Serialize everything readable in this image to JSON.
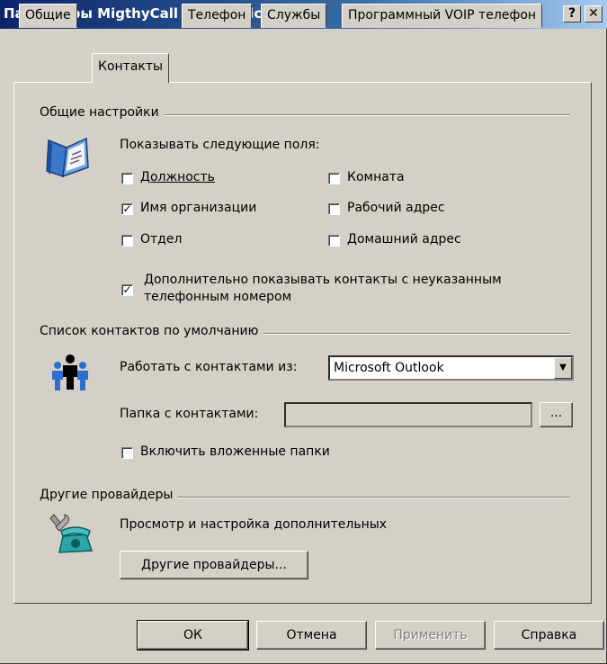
{
  "window": {
    "title": "Параметры MigthyCall Communicator",
    "help_btn": "?",
    "close_btn": "✕"
  },
  "tabs": [
    {
      "label": "Общие"
    },
    {
      "label": "Контакты"
    },
    {
      "label": "Телефон"
    },
    {
      "label": "Службы"
    },
    {
      "label": "Программный VOIP телефон"
    }
  ],
  "general": {
    "group_label": "Общие настройки",
    "show_fields_label": "Показывать следующие поля:",
    "fields": [
      {
        "label": "Должность",
        "checked": false
      },
      {
        "label": "Комната",
        "checked": false
      },
      {
        "label": "Имя организации",
        "checked": true
      },
      {
        "label": "Рабочий адрес",
        "checked": false
      },
      {
        "label": "Отдел",
        "checked": false
      },
      {
        "label": "Домашний адрес",
        "checked": false
      }
    ],
    "extra": {
      "line1": "Дополнительно показывать контакты с неуказанным",
      "line2": "телефонным номером",
      "checked": true
    }
  },
  "default_list": {
    "group_label": "Список контактов по умолчанию",
    "work_with_label": "Работать с контактами из:",
    "work_with_value": "Microsoft Outlook",
    "folder_label": "Папка с контактами:",
    "folder_value": "",
    "browse_label": "...",
    "subfolders_label": "Включить вложенные папки",
    "subfolders_checked": false
  },
  "providers": {
    "group_label": "Другие провайдеры",
    "description": "Просмотр и настройка дополнительных",
    "button_label": "Другие провайдеры..."
  },
  "footer": {
    "ok": "ОК",
    "cancel": "Отмена",
    "apply": "Применить",
    "help": "Справка"
  }
}
